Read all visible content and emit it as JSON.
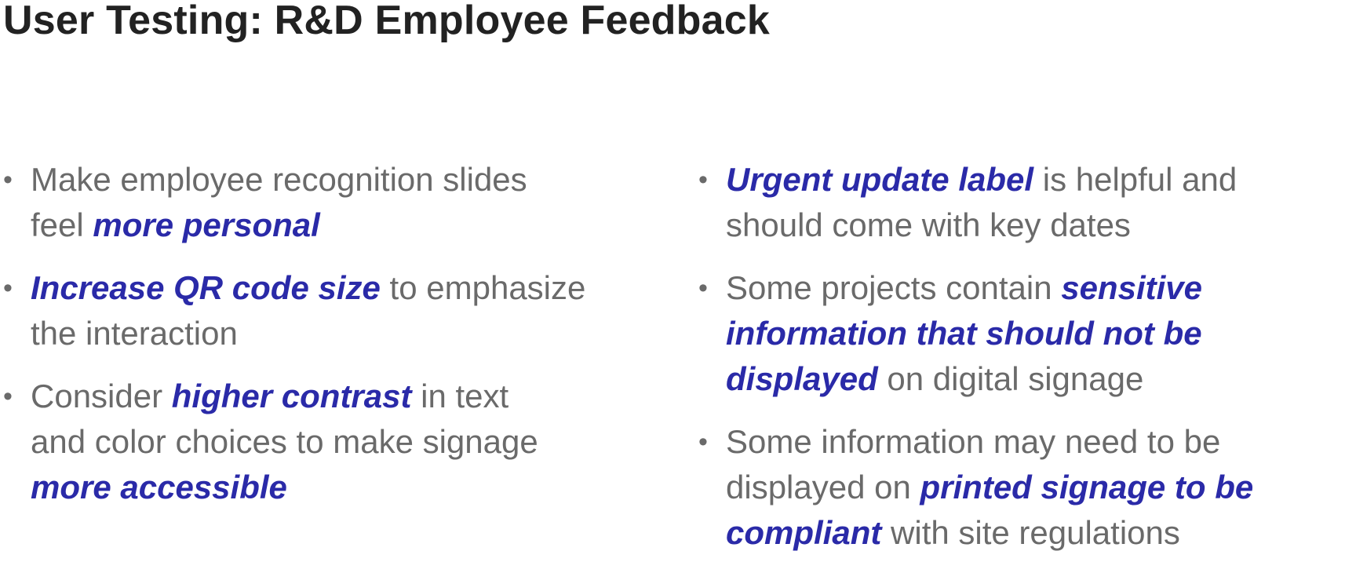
{
  "title": "User Testing: R&D Employee Feedback",
  "colors": {
    "title": "#222222",
    "body_text": "#6a6a6a",
    "emphasis": "#2a2aa8",
    "background": "#ffffff"
  },
  "left_column": {
    "items": [
      {
        "lines": [
          [
            "Make employee recognition slides"
          ],
          [
            "feel ",
            "more personal"
          ]
        ]
      },
      {
        "lines": [
          [
            "Increase QR code size",
            " to emphasize"
          ],
          [
            "the interaction"
          ]
        ]
      },
      {
        "lines": [
          [
            "Consider ",
            "higher contrast",
            " in text"
          ],
          [
            "and color choices to make signage"
          ],
          [
            "more accessible"
          ]
        ]
      }
    ]
  },
  "right_column": {
    "items": [
      {
        "lines": [
          [
            "Urgent update label",
            " is helpful and"
          ],
          [
            "should come with key dates"
          ]
        ]
      },
      {
        "lines": [
          [
            "Some projects contain ",
            "sensitive"
          ],
          [
            "information that should not be"
          ],
          [
            "displayed",
            " on digital signage"
          ]
        ]
      },
      {
        "lines": [
          [
            "Some information may need to be"
          ],
          [
            "displayed on ",
            "printed signage to be"
          ],
          [
            "compliant",
            " with site regulations"
          ]
        ]
      }
    ]
  }
}
